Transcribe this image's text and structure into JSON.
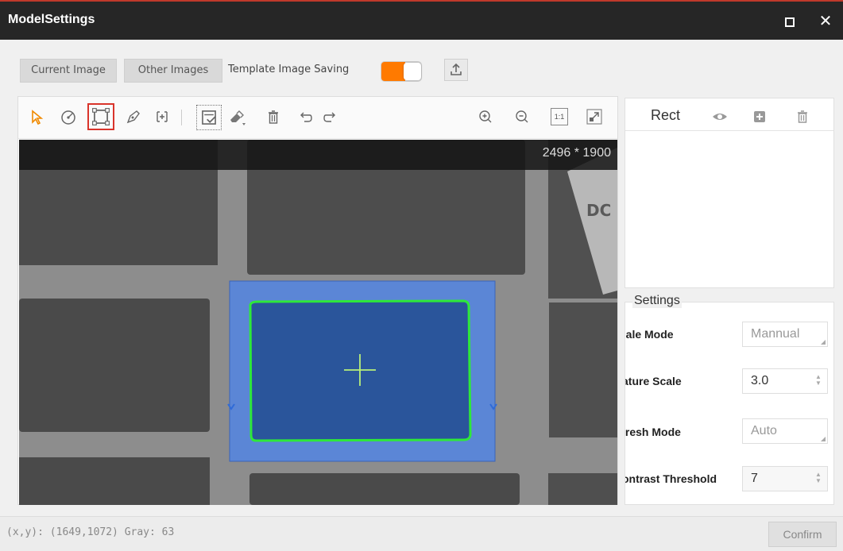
{
  "window": {
    "title": "ModelSettings",
    "maximize_icon": "square-icon",
    "close_icon": "x-icon"
  },
  "toolbar": {
    "current_image_label": "Current Image",
    "other_images_label": "Other Images",
    "template_saving_label": "Template Image Saving",
    "template_saving_enabled": true,
    "toggle_color": "#ff7a00",
    "upload_icon": "upload-icon"
  },
  "image_tools": {
    "left": [
      "cursor-arrow-icon",
      "circle-tool-icon",
      "rectangle-tool-icon",
      "pen-tool-icon",
      "add-region-icon",
      "select-check-icon",
      "eraser-icon",
      "delete-icon",
      "undo-icon",
      "redo-icon"
    ],
    "right": [
      "zoom-in-icon",
      "zoom-out-icon",
      "actual-size-icon",
      "fit-screen-icon"
    ],
    "actual_size_label": "1:1",
    "selected_tool": "rectangle-tool-icon",
    "selected_color": "#d9342b"
  },
  "viewport": {
    "resolution": "2496 * 1900",
    "roi_fill": "#5b86d6",
    "contour_color": "#2ee83a"
  },
  "shape_panel": {
    "shape_type": "Rect",
    "icons": [
      "eye-icon",
      "add-icon",
      "trash-icon"
    ]
  },
  "settings": {
    "title": "Settings",
    "rows": [
      {
        "label": ":ale Mode",
        "value": "Mannual"
      },
      {
        "label": "ature Scale",
        "value": "3.0"
      },
      {
        "label": "ıresh Mode",
        "value": "Auto"
      },
      {
        "label": "ontrast Threshold",
        "value": "7"
      }
    ]
  },
  "status": {
    "coords": "(x,y): (1649,1072) Gray: 63",
    "confirm_label": "Confirm"
  }
}
